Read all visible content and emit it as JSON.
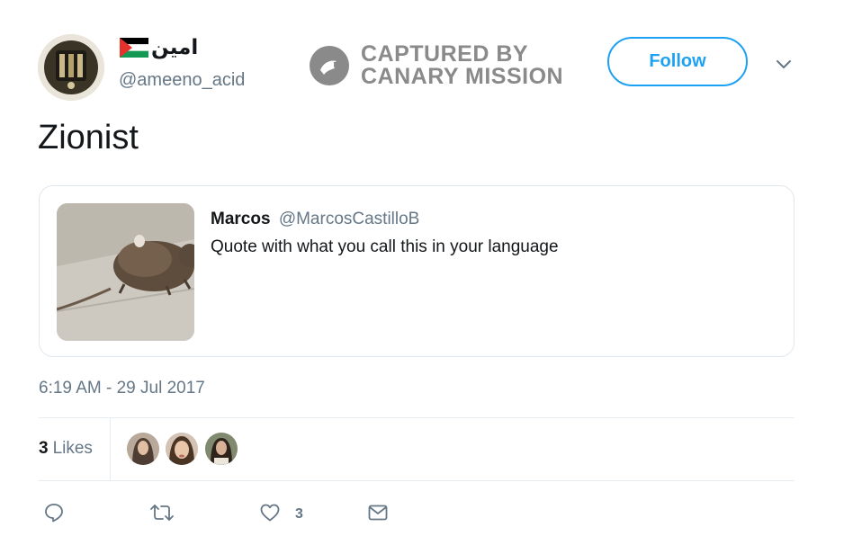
{
  "author": {
    "display_name": "امين",
    "handle": "@ameeno_acid",
    "flag_icon": "palestine-flag-icon"
  },
  "watermark": {
    "line1": "CAPTURED BY",
    "line2": "CANARY MISSION"
  },
  "follow_label": "Follow",
  "tweet": {
    "text": "Zionist",
    "timestamp": "6:19 AM - 29 Jul 2017"
  },
  "quoted_tweet": {
    "name": "Marcos",
    "handle": "@MarcosCastilloB",
    "text": "Quote with what you call this in your language",
    "image_icon": "rat-photo"
  },
  "stats": {
    "likes_count": "3",
    "likes_label": "Likes"
  },
  "actions": {
    "reply_icon": "reply-icon",
    "retweet_icon": "retweet-icon",
    "like_icon": "heart-icon",
    "like_count": "3",
    "dm_icon": "envelope-icon"
  },
  "colors": {
    "accent": "#1da1f2",
    "muted": "#657786",
    "text": "#14171a",
    "border": "#e1e8ed"
  }
}
